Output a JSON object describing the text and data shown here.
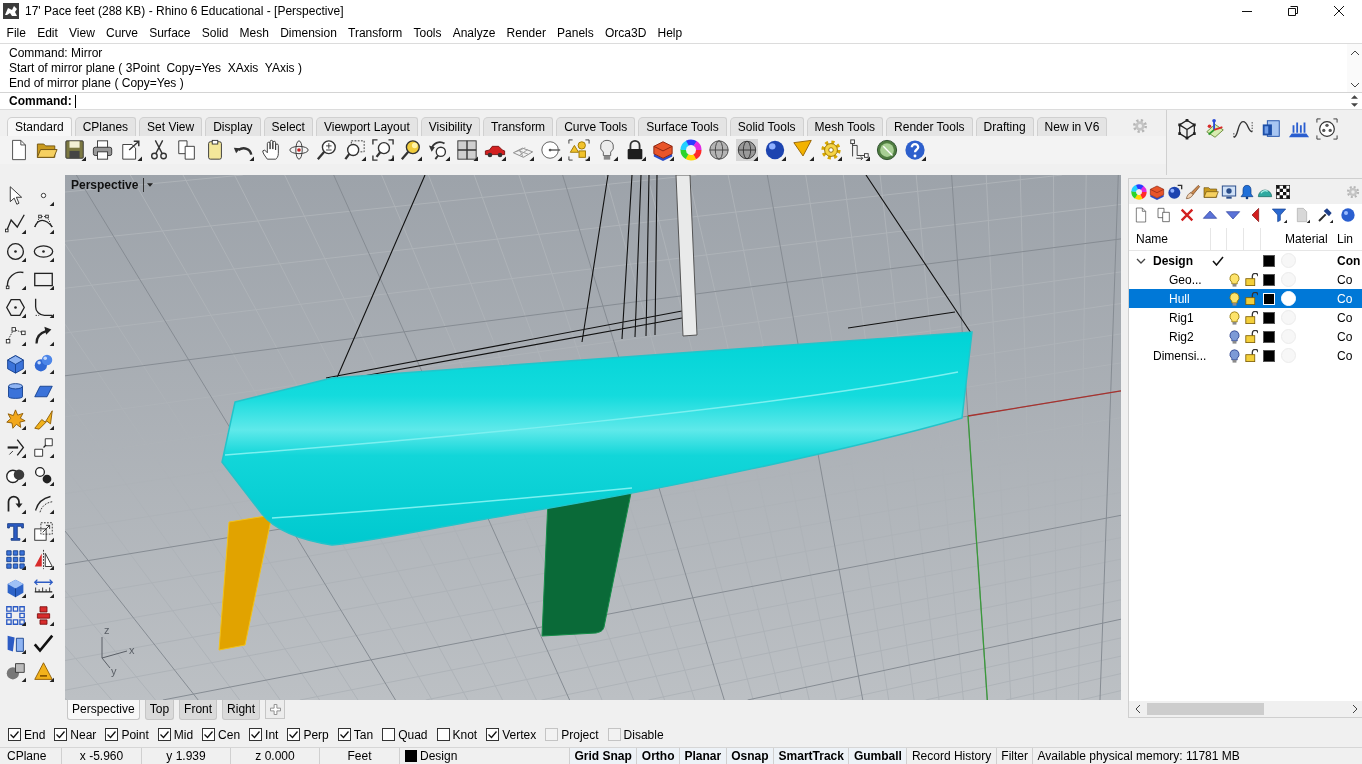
{
  "window": {
    "title": "17' Pace feet (288 KB) - Rhino 6 Educational - [Perspective]"
  },
  "menu_bar": [
    "File",
    "Edit",
    "View",
    "Curve",
    "Surface",
    "Solid",
    "Mesh",
    "Dimension",
    "Transform",
    "Tools",
    "Analyze",
    "Render",
    "Panels",
    "Orca3D",
    "Help"
  ],
  "command_history": [
    "Command: Mirror",
    "Start of mirror plane ( 3Point  Copy=Yes  XAxis  YAxis )",
    "End of mirror plane ( Copy=Yes )"
  ],
  "command_prompt": {
    "label": "Command:"
  },
  "toolbar_tabs": [
    {
      "label": "Standard",
      "selected": true
    },
    {
      "label": "CPlanes",
      "selected": false
    },
    {
      "label": "Set View",
      "selected": false
    },
    {
      "label": "Display",
      "selected": false
    },
    {
      "label": "Select",
      "selected": false
    },
    {
      "label": "Viewport Layout",
      "selected": false
    },
    {
      "label": "Visibility",
      "selected": false
    },
    {
      "label": "Transform",
      "selected": false
    },
    {
      "label": "Curve Tools",
      "selected": false
    },
    {
      "label": "Surface Tools",
      "selected": false
    },
    {
      "label": "Solid Tools",
      "selected": false
    },
    {
      "label": "Mesh Tools",
      "selected": false
    },
    {
      "label": "Render Tools",
      "selected": false
    },
    {
      "label": "Drafting",
      "selected": false
    },
    {
      "label": "New in V6",
      "selected": false
    }
  ],
  "viewport": {
    "title": "Perspective",
    "axis_labels": [
      "z",
      "x",
      "y"
    ]
  },
  "viewport_tabs": [
    {
      "label": "Perspective",
      "selected": true
    },
    {
      "label": "Top",
      "selected": false
    },
    {
      "label": "Front",
      "selected": false
    },
    {
      "label": "Right",
      "selected": false
    }
  ],
  "layers": {
    "columns": [
      "Name",
      "Material",
      "Lin"
    ],
    "rows": [
      {
        "name": "Design",
        "linetype": "Con",
        "color": "#000000",
        "current": true,
        "selected": false,
        "expanded": true,
        "children": [
          {
            "name": "Geo...",
            "linetype": "Co",
            "color": "#000000",
            "current": false,
            "selected": false,
            "on": true,
            "locked": false
          },
          {
            "name": "Hull",
            "linetype": "Co",
            "color": "#000000",
            "current": false,
            "selected": true,
            "on": true,
            "locked": false
          },
          {
            "name": "Rig1",
            "linetype": "Co",
            "color": "#000000",
            "current": false,
            "selected": false,
            "on": true,
            "locked": false
          },
          {
            "name": "Rig2",
            "linetype": "Co",
            "color": "#000000",
            "current": false,
            "selected": false,
            "on": false,
            "locked": false
          }
        ]
      },
      {
        "name": "Dimensi...",
        "linetype": "Co",
        "color": "#000000",
        "current": false,
        "selected": false,
        "on": false,
        "locked": false
      }
    ]
  },
  "osnaps": [
    {
      "label": "End",
      "checked": true,
      "disabled": false
    },
    {
      "label": "Near",
      "checked": true,
      "disabled": false
    },
    {
      "label": "Point",
      "checked": true,
      "disabled": false
    },
    {
      "label": "Mid",
      "checked": true,
      "disabled": false
    },
    {
      "label": "Cen",
      "checked": true,
      "disabled": false
    },
    {
      "label": "Int",
      "checked": true,
      "disabled": false
    },
    {
      "label": "Perp",
      "checked": true,
      "disabled": false
    },
    {
      "label": "Tan",
      "checked": true,
      "disabled": false
    },
    {
      "label": "Quad",
      "checked": false,
      "disabled": false
    },
    {
      "label": "Knot",
      "checked": false,
      "disabled": false
    },
    {
      "label": "Vertex",
      "checked": true,
      "disabled": false
    },
    {
      "label": "Project",
      "checked": false,
      "disabled": true
    },
    {
      "label": "Disable",
      "checked": false,
      "disabled": true
    }
  ],
  "status_bar": {
    "cplane": "CPlane",
    "x": "x -5.960",
    "y": "y 1.939",
    "z": "z 0.000",
    "units": "Feet",
    "layer": {
      "name": "Design",
      "color": "#000000"
    },
    "panes": [
      {
        "label": "Grid Snap",
        "on": true
      },
      {
        "label": "Ortho",
        "on": true
      },
      {
        "label": "Planar",
        "on": true
      },
      {
        "label": "Osnap",
        "on": true
      },
      {
        "label": "SmartTrack",
        "on": true
      },
      {
        "label": "Gumball",
        "on": true
      },
      {
        "label": "Record History",
        "on": false
      },
      {
        "label": "Filter",
        "on": false
      }
    ],
    "memory": "Available physical memory: 11781 MB"
  }
}
